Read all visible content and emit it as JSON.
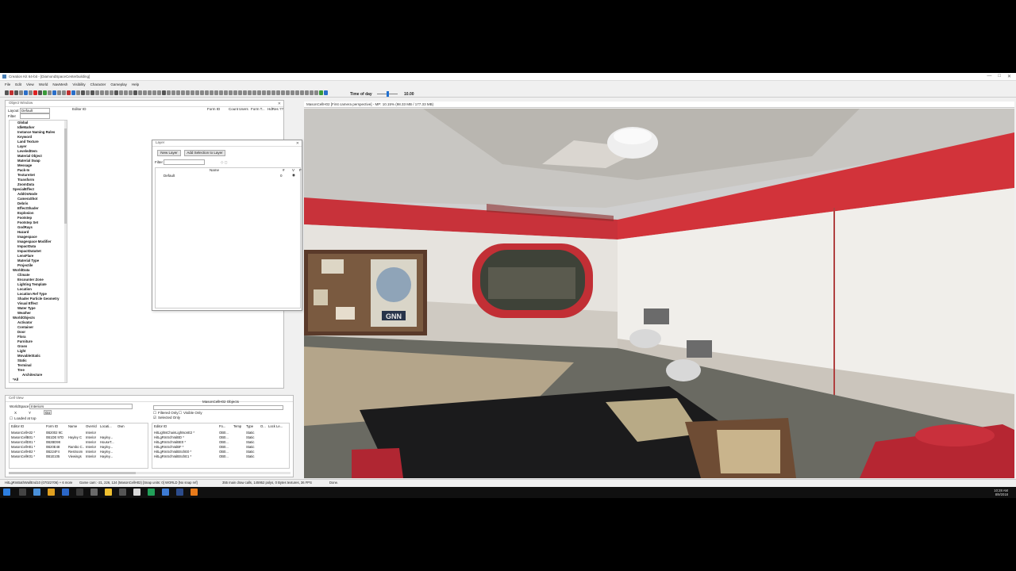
{
  "app": {
    "title": "Creation Kit 64-bit - [DiamondSpaceCenterbuilding]",
    "window_controls": [
      "—",
      "□",
      "✕"
    ]
  },
  "menu": [
    "File",
    "Edit",
    "View",
    "World",
    "NavMesh",
    "Visibility",
    "Character",
    "Gameplay",
    "Help"
  ],
  "toolbar": {
    "time_of_day_label": "Time of day",
    "time_of_day_value": "10.00",
    "time_of_day_fraction": 0.42
  },
  "object_window": {
    "title": "Object Window",
    "layout_label": "Layout",
    "layout_value": "Default",
    "filter_label": "Filter",
    "columns": [
      "Editor ID",
      "Form ID",
      "Count",
      "Users",
      "Form T...",
      "HdRes ??"
    ],
    "tree": [
      {
        "label": "Global",
        "level": 1
      },
      {
        "label": "IdleMarker",
        "level": 1
      },
      {
        "label": "Instance Naming Rules",
        "level": 1
      },
      {
        "label": "Keyword",
        "level": 1
      },
      {
        "label": "Land Texture",
        "level": 1
      },
      {
        "label": "Layer",
        "level": 1
      },
      {
        "label": "LeveledItem",
        "level": 1
      },
      {
        "label": "Material Object",
        "level": 1
      },
      {
        "label": "Material Swap",
        "level": 1
      },
      {
        "label": "Message",
        "level": 1
      },
      {
        "label": "Pack-In",
        "level": 1
      },
      {
        "label": "TextureSet",
        "level": 1
      },
      {
        "label": "Transform",
        "level": 1
      },
      {
        "label": "ZoomData",
        "level": 1
      },
      {
        "label": "SpecialEffect",
        "level": 0
      },
      {
        "label": "AddOnNode",
        "level": 1
      },
      {
        "label": "CameraShot",
        "level": 1
      },
      {
        "label": "Debris",
        "level": 1
      },
      {
        "label": "EffectShader",
        "level": 1
      },
      {
        "label": "Explosion",
        "level": 1
      },
      {
        "label": "Footstep",
        "level": 1
      },
      {
        "label": "Footstep Set",
        "level": 1
      },
      {
        "label": "GodRays",
        "level": 1
      },
      {
        "label": "Hazard",
        "level": 1
      },
      {
        "label": "Imagespace",
        "level": 1
      },
      {
        "label": "Imagespace Modifier",
        "level": 1
      },
      {
        "label": "ImpactData",
        "level": 1
      },
      {
        "label": "ImpactDataSet",
        "level": 1
      },
      {
        "label": "LensFlare",
        "level": 1
      },
      {
        "label": "Material Type",
        "level": 1
      },
      {
        "label": "Projectile",
        "level": 1
      },
      {
        "label": "WorldData",
        "level": 0
      },
      {
        "label": "Climate",
        "level": 1
      },
      {
        "label": "Encounter Zone",
        "level": 1
      },
      {
        "label": "Lighting Template",
        "level": 1
      },
      {
        "label": "Location",
        "level": 1
      },
      {
        "label": "Location Ref Type",
        "level": 1
      },
      {
        "label": "Shader Particle Geometry",
        "level": 1
      },
      {
        "label": "Visual Effect",
        "level": 1
      },
      {
        "label": "Water Type",
        "level": 1
      },
      {
        "label": "Weather",
        "level": 1
      },
      {
        "label": "WorldObjects",
        "level": 0
      },
      {
        "label": "Activator",
        "level": 1
      },
      {
        "label": "Container",
        "level": 1
      },
      {
        "label": "Door",
        "level": 1
      },
      {
        "label": "Flora",
        "level": 1
      },
      {
        "label": "Furniture",
        "level": 1
      },
      {
        "label": "Grass",
        "level": 1
      },
      {
        "label": "Light",
        "level": 1
      },
      {
        "label": "MovableStatic",
        "level": 1
      },
      {
        "label": "Static",
        "level": 1
      },
      {
        "label": "Terminal",
        "level": 1
      },
      {
        "label": "Tree",
        "level": 1
      },
      {
        "label": "Architecture",
        "level": 2
      },
      {
        "label": "*All",
        "level": 0
      }
    ]
  },
  "layer_window": {
    "title": "Layer",
    "new_layer_button": "New Layer",
    "add_selection_button": "Add Selection to Layer",
    "filter_label": "Filter",
    "columns": [
      "Name",
      "#",
      "V",
      "F"
    ],
    "rows": [
      {
        "name": "Default",
        "count": "0"
      }
    ]
  },
  "cell_view": {
    "title": "Cell View",
    "worldspace_label": "WorldSpace",
    "worldspace_value": "Interiors",
    "objects_title": "MasonCellH02 Objects",
    "filtered_only": "Filtered Only",
    "visible_only": "Visible Only",
    "selected_only": "Selected Only",
    "loaded_at_top": "Loaded at top",
    "x_label": "X",
    "y_label": "Y",
    "go_button": "Go",
    "cells_columns": [
      "Editor ID",
      "Form ID",
      "Name",
      "Overrid",
      "Locati...",
      "Own"
    ],
    "cells_rows": [
      [
        "MasonCellA02 *",
        "0B2002 9C",
        "",
        "Interior",
        "",
        ""
      ],
      [
        "MasonCellB01 *",
        "0B1DE 97D",
        "Hayley C",
        "Interior",
        "Hayley...",
        ""
      ],
      [
        "MasonCellD01 *",
        "0B2BD98",
        "",
        "Interior",
        "HouseT...",
        ""
      ],
      [
        "MasonCellH01 *",
        "0B20E48",
        "Rambo C...",
        "Interior",
        "Hayley...",
        ""
      ],
      [
        "MasonCellH02 *",
        "0B224F4",
        "Restroom",
        "Interior",
        "Hayley...",
        ""
      ],
      [
        "MasonCellK01 *",
        "0B1E105",
        "Viewings",
        "Interior",
        "Hayley...",
        ""
      ]
    ],
    "objects_columns": [
      "Editor ID",
      "Fo...",
      "Temp",
      "Type",
      "O...",
      "Lock Le..."
    ],
    "objects_rows": [
      [
        "HitLightsChainLightsonE2 *",
        "OB0...",
        "",
        "Static",
        "",
        ""
      ],
      [
        "HitLgRmSchValBD *",
        "OB0...",
        "",
        "Static",
        "",
        ""
      ],
      [
        "HitLgRmSchValBE0 *",
        "OB0...",
        "",
        "Static",
        "",
        ""
      ],
      [
        "HitLgRmSchValBF *",
        "OB0...",
        "",
        "Static",
        "",
        ""
      ],
      [
        "HitLgRmSchValBSchE0 *",
        "OB0...",
        "",
        "Static",
        "",
        ""
      ],
      [
        "HitLgRmSchValBSchE1 *",
        "OB0...",
        "",
        "Static",
        "",
        ""
      ]
    ]
  },
  "viewport": {
    "title": "MasonCellH02 [First camera perspective] - MP: 10.15% (98.33 MB / 177.33 MB)"
  },
  "status": {
    "selection": "HitLgRmBathWallEnd10 (07022706) + 6 more",
    "camera": "Game cam: -21, 226, 124 (MasonCellH02) [Snap units: 0] WORLD [No snap ref]",
    "stats": "355 main draw calls, 145952 polys, 0 Bytes textures, 36 FPS",
    "done": "Done."
  },
  "taskbar": {
    "time": "10:28 AM",
    "date": "8/9/2018"
  },
  "colors": {
    "accent": "#1f6fd0",
    "stripe_red": "#d2333a",
    "taskbar": "#101010"
  }
}
